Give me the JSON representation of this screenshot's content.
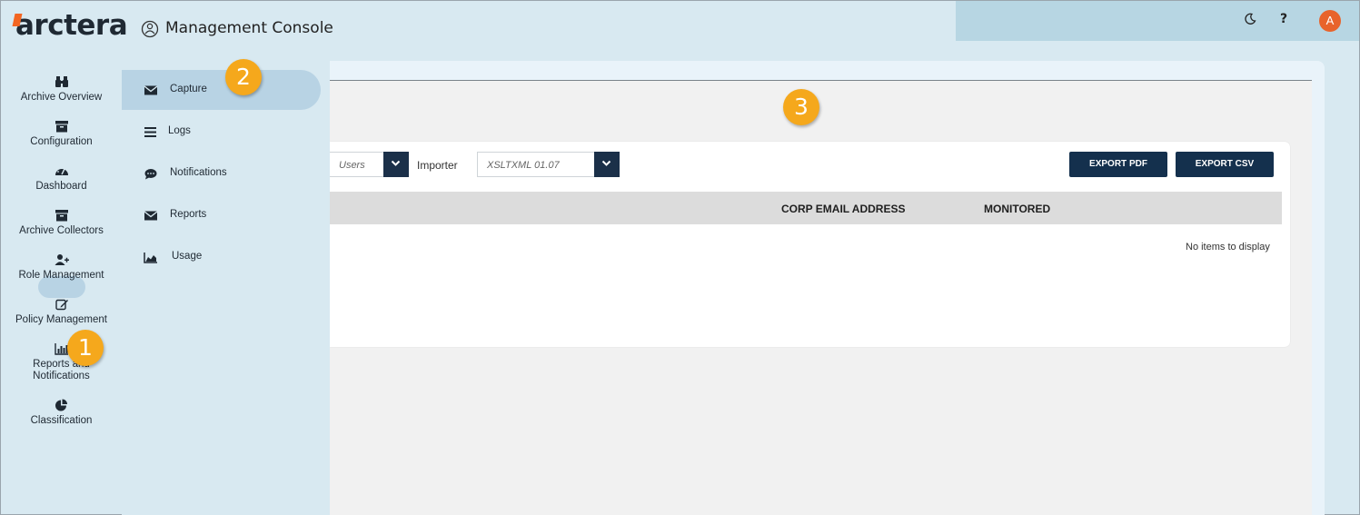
{
  "header": {
    "logo_text": "arctera",
    "title": "Management Console",
    "help_label": "?",
    "avatar_initial": "A"
  },
  "sidebar": {
    "items": [
      {
        "label": "Archive Overview",
        "icon": "binoculars-icon"
      },
      {
        "label": "Configuration",
        "icon": "archive-box-icon"
      },
      {
        "label": "Dashboard",
        "icon": "gauge-icon"
      },
      {
        "label": "Archive Collectors",
        "icon": "archive-box-icon"
      },
      {
        "label": "Role Management",
        "icon": "user-plus-icon"
      },
      {
        "label": "Policy Management",
        "icon": "edit-icon"
      },
      {
        "label": "Reports and Notifications",
        "icon": "bar-chart-icon"
      },
      {
        "label": "Classification",
        "icon": "pie-chart-icon"
      }
    ],
    "active_index": 6
  },
  "subnav": {
    "items": [
      {
        "label": "Capture",
        "icon": "envelope-icon",
        "active": true
      },
      {
        "label": "Logs",
        "icon": "list-icon",
        "active": false
      },
      {
        "label": "Notifications",
        "icon": "comment-icon",
        "active": false
      },
      {
        "label": "Reports",
        "icon": "envelope-icon",
        "active": false
      },
      {
        "label": "Usage",
        "icon": "area-chart-icon",
        "active": false
      }
    ]
  },
  "toolbar": {
    "filter_value": "Users",
    "importer_label": "Importer",
    "importer_value": "XSLTXML 01.07",
    "export_pdf_label": "EXPORT PDF",
    "export_csv_label": "EXPORT CSV"
  },
  "table": {
    "columns": [
      "CORP EMAIL ADDRESS",
      "MONITORED"
    ],
    "empty_message": "No items to display"
  },
  "callouts": [
    "1",
    "2",
    "3"
  ],
  "colors": {
    "accent_navy": "#14304d",
    "callout_orange": "#f5a81c",
    "avatar_orange": "#e8632b",
    "nav_bg": "#d8e9f1"
  }
}
